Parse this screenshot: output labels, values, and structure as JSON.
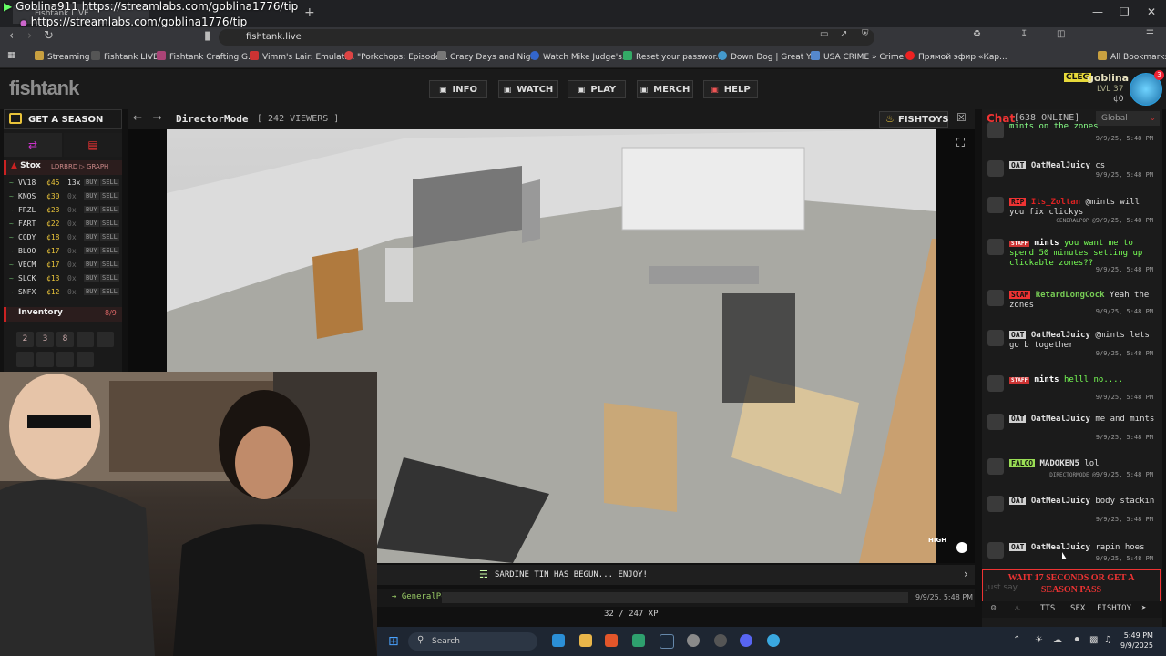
{
  "browser": {
    "overlay_name": "Goblina911",
    "overlay_url_top": "https://streamlabs.com/goblina1776/tip",
    "overlay_url": "https://streamlabs.com/goblina1776/tip",
    "tab_title": "Fishtank LIVE",
    "url": "fishtank.live",
    "bookmarks": [
      "Streaming",
      "Fishtank LIVE",
      "Fishtank Crafting G...",
      "Vimm's Lair: Emulati...",
      "\"Porkchops: Episode...",
      "Crazy Days and Nig...",
      "Watch Mike Judge's...",
      "Reset your passwor...",
      "Down Dog | Great Y...",
      "USA CRIME » Crime...",
      "Прямой эфир «Кар...",
      "All Bookmarks"
    ]
  },
  "site": {
    "logo": "fishtank",
    "nav": [
      "INFO",
      "WATCH",
      "PLAY",
      "MERCH",
      "HELP"
    ],
    "user": {
      "clan": "CLEG",
      "name": "goblina",
      "level": "LVL 37",
      "coins": "¢0",
      "badge": "3"
    }
  },
  "sidebar": {
    "season_pass": "GET A SEASON PASS",
    "stox_title": "Stox",
    "stox_sub": "LDRBRD ▷ GRAPH",
    "stocks": [
      {
        "sym": "VV18",
        "price": "¢45",
        "qty": "13x"
      },
      {
        "sym": "KNOS",
        "price": "¢30",
        "qty": "0x"
      },
      {
        "sym": "FRZL",
        "price": "¢23",
        "qty": "0x"
      },
      {
        "sym": "FART",
        "price": "¢22",
        "qty": "0x"
      },
      {
        "sym": "CODY",
        "price": "¢18",
        "qty": "0x"
      },
      {
        "sym": "BLOO",
        "price": "¢17",
        "qty": "0x"
      },
      {
        "sym": "VECM",
        "price": "¢17",
        "qty": "0x"
      },
      {
        "sym": "SLCK",
        "price": "¢13",
        "qty": "0x"
      },
      {
        "sym": "SNFX",
        "price": "¢12",
        "qty": "0x"
      }
    ],
    "buy_label": "BUY",
    "sell_label": "SELL",
    "inventory_title": "Inventory",
    "inventory_count": "8/9",
    "inventory_slots": [
      "2",
      "3",
      "8",
      "",
      "",
      "",
      "",
      "",
      ""
    ]
  },
  "stream": {
    "title": "DirectorMode",
    "viewers": "[ 242 VIEWERS ]",
    "fishtoys": "FISHTOYS",
    "quality": "HIGH",
    "announcement": "SARDINE TIN HAS BEGUN... ENJOY!",
    "last_user": "GeneralPop",
    "last_time": "9/9/25, 5:48 PM",
    "xp": "32 / 247 XP"
  },
  "chat": {
    "title": "Chat",
    "online": "[638 ONLINE]",
    "scope": "Global",
    "messages": [
      {
        "clan": "",
        "clan_color": "#bbb",
        "user": "",
        "user_color": "#ddd",
        "text": "mints on the zones",
        "text_color": "#8f8",
        "reply": "",
        "time": "9/9/25, 5:48 PM"
      },
      {
        "clan": "OAT",
        "clan_color": "#d0d0d0",
        "user": "OatMealJuicy",
        "user_color": "#e0e0e0",
        "text": "cs",
        "text_color": "#ddd",
        "reply": "",
        "time": "9/9/25, 5:48 PM"
      },
      {
        "clan": "RIP",
        "clan_color": "#e33",
        "user": "Its_Zoltan",
        "user_color": "#d22",
        "text": "@mints will you fix clickys",
        "text_color": "#ddd",
        "reply": "GENERALPOP @",
        "time": "9/9/25, 5:48 PM"
      },
      {
        "clan": "",
        "clan_color": "#bbb",
        "user": "mints",
        "user_color": "#fff",
        "text": "you want me to spend 50 minutes setting up clickable zones??",
        "text_color": "#7f5",
        "reply": "",
        "time": "9/9/25, 5:48 PM"
      },
      {
        "clan": "SCAM",
        "clan_color": "#e33",
        "user": "RetardLongCock",
        "user_color": "#7c5",
        "text": "Yeah the zones",
        "text_color": "#ddd",
        "reply": "",
        "time": "9/9/25, 5:48 PM"
      },
      {
        "clan": "OAT",
        "clan_color": "#d0d0d0",
        "user": "OatMealJuicy",
        "user_color": "#e0e0e0",
        "text": "@mints lets go b together",
        "text_color": "#ddd",
        "reply": "",
        "time": "9/9/25, 5:48 PM"
      },
      {
        "clan": "",
        "clan_color": "#bbb",
        "user": "mints",
        "user_color": "#fff",
        "text": "helll no....",
        "text_color": "#7f5",
        "reply": "",
        "time": "9/9/25, 5:48 PM"
      },
      {
        "clan": "OAT",
        "clan_color": "#d0d0d0",
        "user": "OatMealJuicy",
        "user_color": "#e0e0e0",
        "text": "me and mints",
        "text_color": "#ddd",
        "reply": "",
        "time": "9/9/25, 5:48 PM"
      },
      {
        "clan": "FALCO",
        "clan_color": "#9d5",
        "user": "MADOKEN5",
        "user_color": "#e0e0e0",
        "text": "lol",
        "text_color": "#ddd",
        "reply": "DIRECTORMODE @",
        "time": "9/9/25, 5:48 PM"
      },
      {
        "clan": "OAT",
        "clan_color": "#d0d0d0",
        "user": "OatMealJuicy",
        "user_color": "#e0e0e0",
        "text": "body stackin",
        "text_color": "#ddd",
        "reply": "",
        "time": "9/9/25, 5:48 PM"
      },
      {
        "clan": "OAT",
        "clan_color": "#d0d0d0",
        "user": "OatMealJuicy",
        "user_color": "#e0e0e0",
        "text": "rapin hoes",
        "text_color": "#ddd",
        "reply": "",
        "time": "9/9/25, 5:48 PM"
      }
    ],
    "staff_label": "STAFF",
    "wait_notice": "WAIT 17 SECONDS OR GET A SEASON PASS",
    "input_placeholder": "Just say",
    "tools": [
      "TTS",
      "SFX",
      "FISHTOY"
    ]
  },
  "taskbar": {
    "search": "Search",
    "time": "5:49 PM",
    "date": "9/9/2025"
  }
}
